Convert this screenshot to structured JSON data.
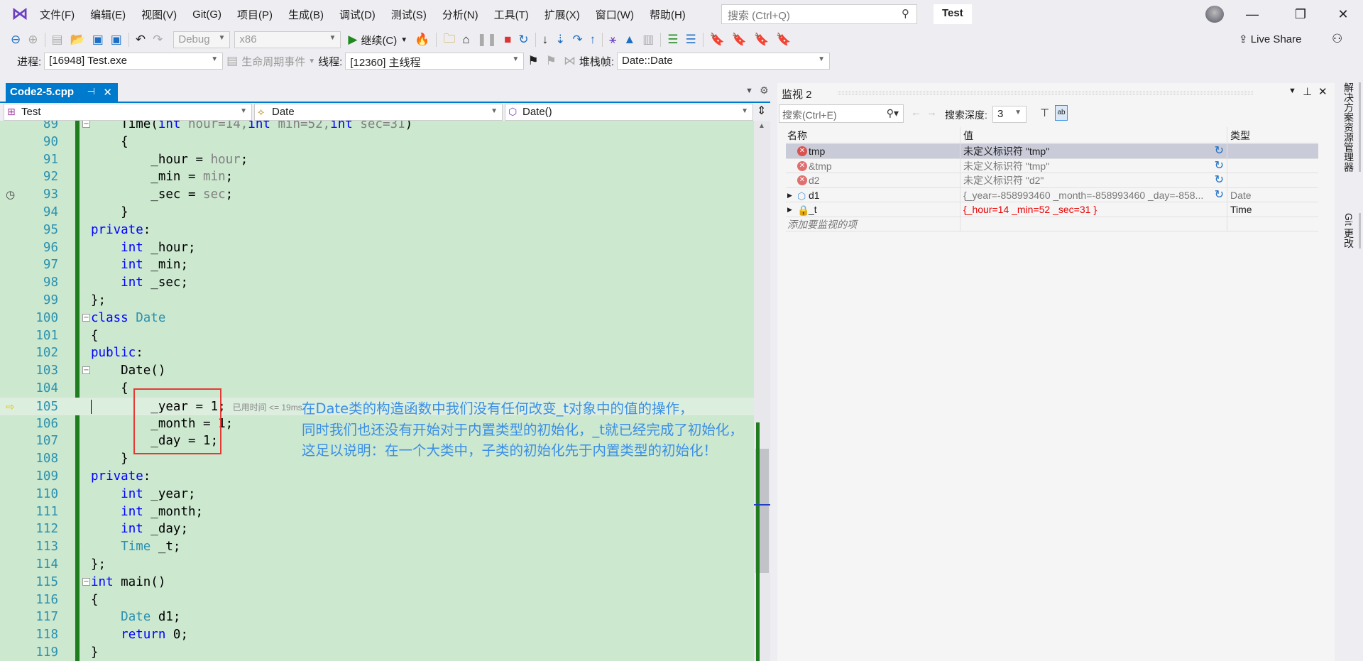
{
  "menu": [
    "文件(F)",
    "编辑(E)",
    "视图(V)",
    "Git(G)",
    "项目(P)",
    "生成(B)",
    "调试(D)",
    "测试(S)",
    "分析(N)",
    "工具(T)",
    "扩展(X)",
    "窗口(W)",
    "帮助(H)"
  ],
  "search": {
    "placeholder": "搜索 (Ctrl+Q)"
  },
  "solution_name": "Test",
  "toolbar": {
    "config": "Debug",
    "platform": "x86",
    "continue_label": "继续(C)",
    "live_share": "Live Share"
  },
  "debug_bar": {
    "process_label": "进程:",
    "process_value": "[16948] Test.exe",
    "lifecycle_label": "生命周期事件",
    "thread_label": "线程:",
    "thread_value": "[12360] 主线程",
    "stackframe_label": "堆栈帧:",
    "stackframe_value": "Date::Date"
  },
  "editor": {
    "tab_label": "Code2-5.cpp",
    "nav": {
      "project": "Test",
      "scope": "Date",
      "member": "Date()"
    },
    "current_line": 105,
    "lines": [
      {
        "n": 89,
        "fold": true,
        "t": [
          [
            "    ",
            "plain"
          ],
          [
            "Time",
            "plain"
          ],
          [
            "(",
            "plain"
          ],
          [
            "int",
            "kw"
          ],
          [
            " hour=14,",
            "param"
          ],
          [
            "int",
            "kw"
          ],
          [
            " min=52,",
            "param"
          ],
          [
            "int",
            "kw"
          ],
          [
            " sec=31",
            "param"
          ],
          [
            ")",
            "plain"
          ]
        ]
      },
      {
        "n": 90,
        "t": [
          [
            "    {",
            "plain"
          ]
        ]
      },
      {
        "n": 91,
        "t": [
          [
            "        _hour = ",
            "plain"
          ],
          [
            "hour",
            "param"
          ],
          [
            ";",
            "plain"
          ]
        ]
      },
      {
        "n": 92,
        "t": [
          [
            "        _min = ",
            "plain"
          ],
          [
            "min",
            "param"
          ],
          [
            ";",
            "plain"
          ]
        ]
      },
      {
        "n": 93,
        "t": [
          [
            "        _sec = ",
            "plain"
          ],
          [
            "sec",
            "param"
          ],
          [
            ";",
            "plain"
          ]
        ]
      },
      {
        "n": 94,
        "t": [
          [
            "    }",
            "plain"
          ]
        ]
      },
      {
        "n": 95,
        "t": [
          [
            "private",
            "kw"
          ],
          [
            ":",
            "plain"
          ]
        ]
      },
      {
        "n": 96,
        "t": [
          [
            "    ",
            "plain"
          ],
          [
            "int",
            "kw"
          ],
          [
            " _hour;",
            "plain"
          ]
        ]
      },
      {
        "n": 97,
        "t": [
          [
            "    ",
            "plain"
          ],
          [
            "int",
            "kw"
          ],
          [
            " _min;",
            "plain"
          ]
        ]
      },
      {
        "n": 98,
        "t": [
          [
            "    ",
            "plain"
          ],
          [
            "int",
            "kw"
          ],
          [
            " _sec;",
            "plain"
          ]
        ]
      },
      {
        "n": 99,
        "t": [
          [
            "};",
            "plain"
          ]
        ]
      },
      {
        "n": 100,
        "fold": true,
        "t": [
          [
            "class",
            "kw"
          ],
          [
            " ",
            "plain"
          ],
          [
            "Date",
            "type"
          ]
        ]
      },
      {
        "n": 101,
        "t": [
          [
            "{",
            "plain"
          ]
        ]
      },
      {
        "n": 102,
        "t": [
          [
            "public",
            "kw"
          ],
          [
            ":",
            "plain"
          ]
        ]
      },
      {
        "n": 103,
        "fold": true,
        "t": [
          [
            "    Date()",
            "plain"
          ]
        ]
      },
      {
        "n": 104,
        "t": [
          [
            "    {",
            "plain"
          ]
        ]
      },
      {
        "n": 105,
        "t": [
          [
            "        _year = 1;",
            "plain"
          ]
        ],
        "hint": "已用时间 <= 19ms"
      },
      {
        "n": 106,
        "t": [
          [
            "        _month = 1;",
            "plain"
          ]
        ]
      },
      {
        "n": 107,
        "t": [
          [
            "        _day = 1;",
            "plain"
          ]
        ]
      },
      {
        "n": 108,
        "t": [
          [
            "    }",
            "plain"
          ]
        ]
      },
      {
        "n": 109,
        "t": [
          [
            "private",
            "kw"
          ],
          [
            ":",
            "plain"
          ]
        ]
      },
      {
        "n": 110,
        "t": [
          [
            "    ",
            "plain"
          ],
          [
            "int",
            "kw"
          ],
          [
            " _year;",
            "plain"
          ]
        ]
      },
      {
        "n": 111,
        "t": [
          [
            "    ",
            "plain"
          ],
          [
            "int",
            "kw"
          ],
          [
            " _month;",
            "plain"
          ]
        ]
      },
      {
        "n": 112,
        "t": [
          [
            "    ",
            "plain"
          ],
          [
            "int",
            "kw"
          ],
          [
            " _day;",
            "plain"
          ]
        ]
      },
      {
        "n": 113,
        "t": [
          [
            "    ",
            "plain"
          ],
          [
            "Time",
            "type"
          ],
          [
            " _t;",
            "plain"
          ]
        ]
      },
      {
        "n": 114,
        "t": [
          [
            "};",
            "plain"
          ]
        ]
      },
      {
        "n": 115,
        "fold": true,
        "t": [
          [
            "int",
            "kw"
          ],
          [
            " main()",
            "plain"
          ]
        ]
      },
      {
        "n": 116,
        "t": [
          [
            "{",
            "plain"
          ]
        ]
      },
      {
        "n": 117,
        "t": [
          [
            "    ",
            "plain"
          ],
          [
            "Date",
            "type"
          ],
          [
            " d1;",
            "plain"
          ]
        ]
      },
      {
        "n": 118,
        "t": [
          [
            "    ",
            "plain"
          ],
          [
            "return",
            "kw"
          ],
          [
            " 0;",
            "plain"
          ]
        ]
      },
      {
        "n": 119,
        "t": [
          [
            "}",
            "plain"
          ]
        ]
      }
    ]
  },
  "annotation": {
    "lines": [
      "在Date类的构造函数中我们没有任何改变_t对象中的值的操作，",
      "同时我们也还没有开始对于内置类型的初始化，_t就已经完成了初始化，",
      "这足以说明：在一个大类中，子类的初始化先于内置类型的初始化！"
    ],
    "color": "#3a8ee6"
  },
  "watch": {
    "title": "监视 2",
    "search_placeholder": "搜索(Ctrl+E)",
    "depth_label": "搜索深度:",
    "depth_value": "3",
    "columns": [
      "名称",
      "值",
      "类型"
    ],
    "rows": [
      {
        "name": "tmp",
        "value": "未定义标识符 \"tmp\"",
        "type": "",
        "icon": "error",
        "selected": true
      },
      {
        "name": "&tmp",
        "value": "未定义标识符 \"tmp\"",
        "type": "",
        "icon": "error"
      },
      {
        "name": "d2",
        "value": "未定义标识符 \"d2\"",
        "type": "",
        "icon": "error"
      },
      {
        "name": "d1",
        "value": "{_year=-858993460 _month=-858993460 _day=-858...",
        "type": "Date",
        "icon": "object",
        "expandable": true
      },
      {
        "name": "_t",
        "value": "{_hour=14 _min=52 _sec=31 }",
        "type": "Time",
        "icon": "object-locked",
        "expandable": true,
        "changed": true
      }
    ],
    "add_placeholder": "添加要监视的项"
  },
  "side_tabs": [
    "解决方案资源管理器",
    "Git 更改"
  ]
}
